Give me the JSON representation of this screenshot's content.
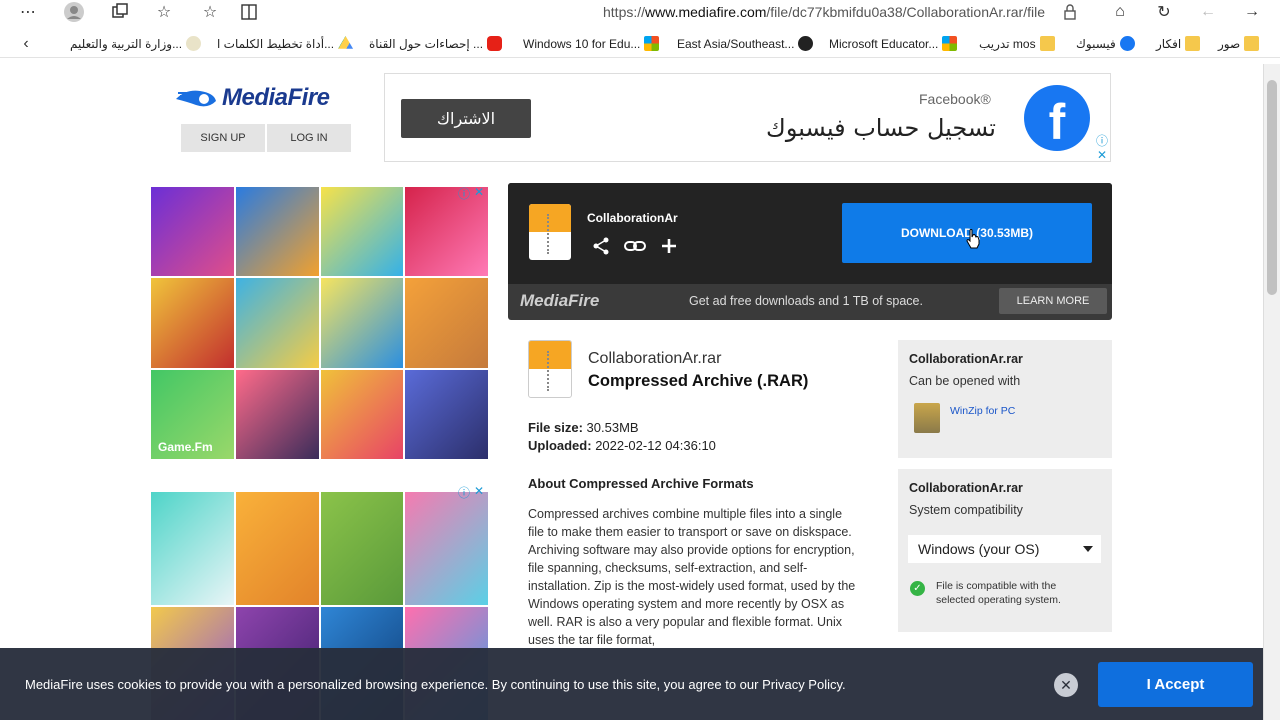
{
  "browser": {
    "url_prefix": "https://",
    "url_domain": "www.mediafire.com",
    "url_path": "/file/dc77kbmifdu0a38/CollaborationAr.rar/file",
    "bookmarks": [
      {
        "label": "صور",
        "icon": "folder-icon"
      },
      {
        "label": "افكار",
        "icon": "folder-icon"
      },
      {
        "label": "فيسبوك",
        "icon": "facebook-icon"
      },
      {
        "label": "تدريب mos",
        "icon": "folder-icon"
      },
      {
        "label": "Microsoft Educator...",
        "icon": "windows-icon"
      },
      {
        "label": "East Asia/Southeast...",
        "icon": "site-icon"
      },
      {
        "label": "Windows 10 for Edu...",
        "icon": "windows-icon"
      },
      {
        "label": "إحصاءات حول القناة ...",
        "icon": "youtube-icon"
      },
      {
        "label": "أداة تخطيط الكلمات ا...",
        "icon": "drive-icon"
      },
      {
        "label": "وزارة التربية والتعليم...",
        "icon": "site-icon"
      }
    ]
  },
  "header": {
    "logo": "MediaFire",
    "signup": "SIGN UP",
    "login": "LOG IN"
  },
  "fb_ad": {
    "button": "الاشتراك",
    "brand": "Facebook®",
    "title": "تسجيل حساب فيسبوك",
    "logo_letter": "f"
  },
  "left_ads": {
    "brand": "Game.Fm"
  },
  "download_panel": {
    "filename": "CollaborationAr",
    "download_label": "DOWNLOAD (30.53MB)",
    "promo_logo": "MediaFire",
    "promo_text": "Get ad free downloads and 1 TB of space.",
    "learn_more": "LEARN MORE"
  },
  "file_info": {
    "name": "CollaborationAr.rar",
    "type": "Compressed Archive (.RAR)",
    "size_label": "File size:",
    "size_value": "30.53MB",
    "uploaded_label": "Uploaded:",
    "uploaded_value": "2022-02-12 04:36:10",
    "about_heading": "About Compressed Archive Formats",
    "about_text": "Compressed archives combine multiple files into a single file to make them easier to transport or save on diskspace. Archiving software may also provide options for encryption, file spanning, checksums, self-extraction, and self-installation. Zip is the most-widely used format, used by the Windows operating system and more recently by OSX as well. RAR is also a very popular and flexible format. Unix uses the tar file format,"
  },
  "opened_with": {
    "title": "CollaborationAr.rar",
    "subtitle": "Can be opened with",
    "app": "WinZip for PC"
  },
  "compat_box": {
    "title": "CollaborationAr.rar",
    "subtitle": "System compatibility",
    "os_selected": "Windows (your OS)",
    "message": "File is compatible with the selected operating system."
  },
  "cookie": {
    "text": "MediaFire uses cookies to provide you with a personalized browsing experience. By continuing to use this site, you agree to our Privacy Policy.",
    "close": "✕",
    "accept": "I Accept"
  }
}
